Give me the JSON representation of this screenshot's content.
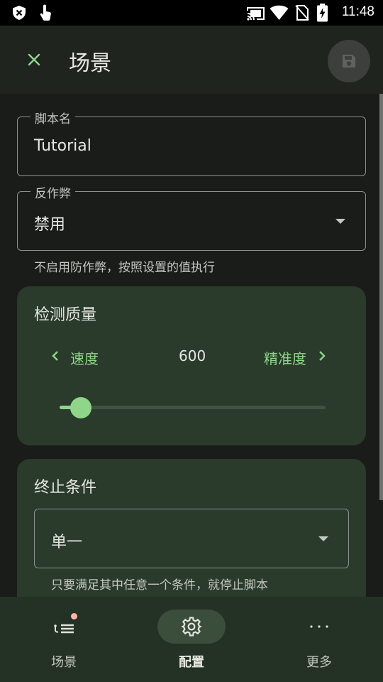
{
  "status_bar": {
    "time": "11:48",
    "icons": [
      "shield-x-icon",
      "touch-icon",
      "cast-icon",
      "wifi-icon",
      "no-sim-icon",
      "battery-charging-icon"
    ]
  },
  "app_bar": {
    "title": "场景",
    "close_icon": "close-icon",
    "save_icon": "save-icon"
  },
  "form": {
    "script_name": {
      "label": "脚本名",
      "value": "Tutorial"
    },
    "anti_cheat": {
      "label": "反作弊",
      "value": "禁用",
      "helper": "不启用防作弊，按照设置的值执行"
    }
  },
  "detection_quality": {
    "title": "检测质量",
    "left_option": "速度",
    "value": "600",
    "right_option": "精准度",
    "slider_level": 0.08
  },
  "termination": {
    "title": "终止条件",
    "value": "单一",
    "helper": "只要满足其中任意一个条件，就停止脚本"
  },
  "bottom_nav": {
    "items": [
      {
        "label": "场景",
        "icon": "scene-list-icon",
        "active": false
      },
      {
        "label": "配置",
        "icon": "gear-icon",
        "active": true
      },
      {
        "label": "更多",
        "icon": "more-icon",
        "active": false
      }
    ]
  },
  "colors": {
    "accent": "#8fd68a",
    "background": "#191c19",
    "card": "#2a3a2b",
    "nav": "#243125"
  }
}
